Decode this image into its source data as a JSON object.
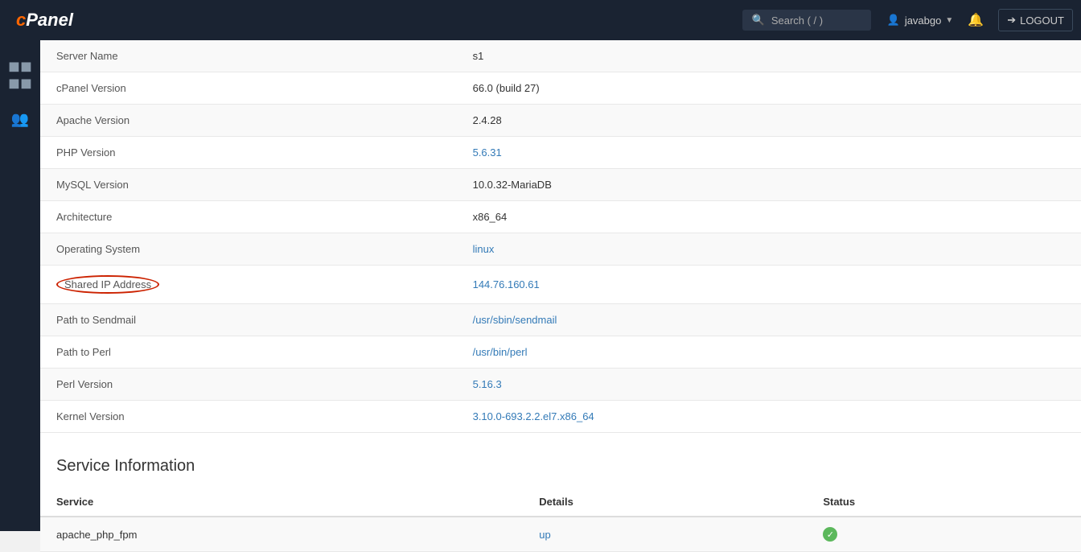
{
  "navbar": {
    "brand": "cPanel",
    "search_placeholder": "Search ( / )",
    "username": "javabgo",
    "logout_label": "LOGOUT"
  },
  "sidebar": {
    "items": [
      {
        "icon": "grid",
        "label": "Dashboard"
      },
      {
        "icon": "users",
        "label": "Users"
      }
    ]
  },
  "server_info": {
    "rows": [
      {
        "label": "Server Name",
        "value": "s1",
        "link": false
      },
      {
        "label": "cPanel Version",
        "value": "66.0 (build 27)",
        "link": false
      },
      {
        "label": "Apache Version",
        "value": "2.4.28",
        "link": false
      },
      {
        "label": "PHP Version",
        "value": "5.6.31",
        "link": true
      },
      {
        "label": "MySQL Version",
        "value": "10.0.32-MariaDB",
        "link": false
      },
      {
        "label": "Architecture",
        "value": "x86_64",
        "link": false
      },
      {
        "label": "Operating System",
        "value": "linux",
        "link": true
      },
      {
        "label": "Shared IP Address",
        "value": "144.76.160.61",
        "link": true,
        "highlight": true
      },
      {
        "label": "Path to Sendmail",
        "value": "/usr/sbin/sendmail",
        "link": true
      },
      {
        "label": "Path to Perl",
        "value": "/usr/bin/perl",
        "link": true
      },
      {
        "label": "Perl Version",
        "value": "5.16.3",
        "link": true
      },
      {
        "label": "Kernel Version",
        "value": "3.10.0-693.2.2.el7.x86_64",
        "link": true
      }
    ]
  },
  "service_info": {
    "section_title": "Service Information",
    "columns": [
      "Service",
      "Details",
      "Status"
    ],
    "rows": [
      {
        "service": "apache_php_fpm",
        "details": "up",
        "status": "ok"
      }
    ]
  }
}
